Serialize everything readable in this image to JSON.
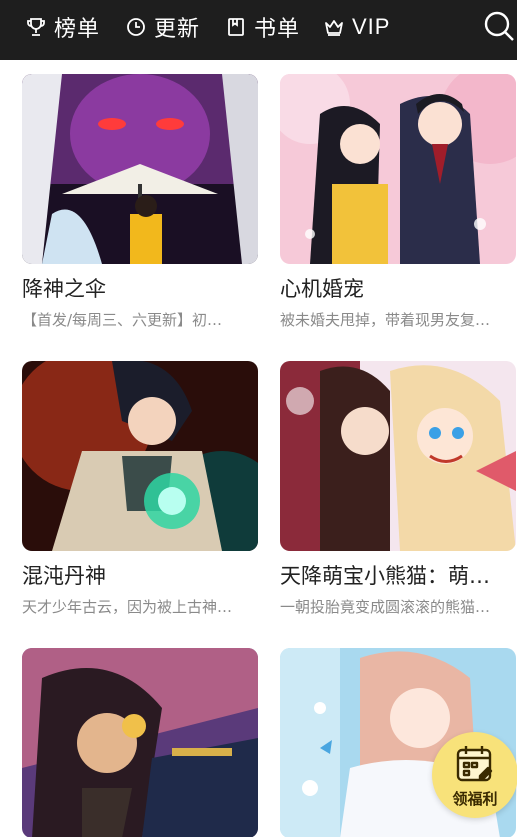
{
  "nav": {
    "items": [
      {
        "label": "榜单",
        "icon": "trophy-icon"
      },
      {
        "label": "更新",
        "icon": "clock-icon"
      },
      {
        "label": "书单",
        "icon": "bookmark-icon"
      },
      {
        "label": "VIP",
        "icon": "crown-icon"
      }
    ],
    "search_icon": "search-icon"
  },
  "comics": [
    {
      "title": "降神之伞",
      "desc": "【首发/每周三、六更新】初…"
    },
    {
      "title": "心机婚宠",
      "desc": "被未婚夫甩掉，带着现男友复…"
    },
    {
      "title": "混沌丹神",
      "desc": "天才少年古云，因为被上古神…"
    },
    {
      "title": "天降萌宝小熊猫：萌…",
      "desc": "一朝投胎竟变成圆滚滚的熊猫…"
    },
    {
      "title": "",
      "desc": ""
    },
    {
      "title": "",
      "desc": ""
    }
  ],
  "welfare": {
    "label": "领福利",
    "icon": "calendar-icon",
    "color": "#f8e27a"
  },
  "colors": {
    "topbar": "#1e1e1e",
    "title": "#222222",
    "desc": "#8a8a8a"
  }
}
